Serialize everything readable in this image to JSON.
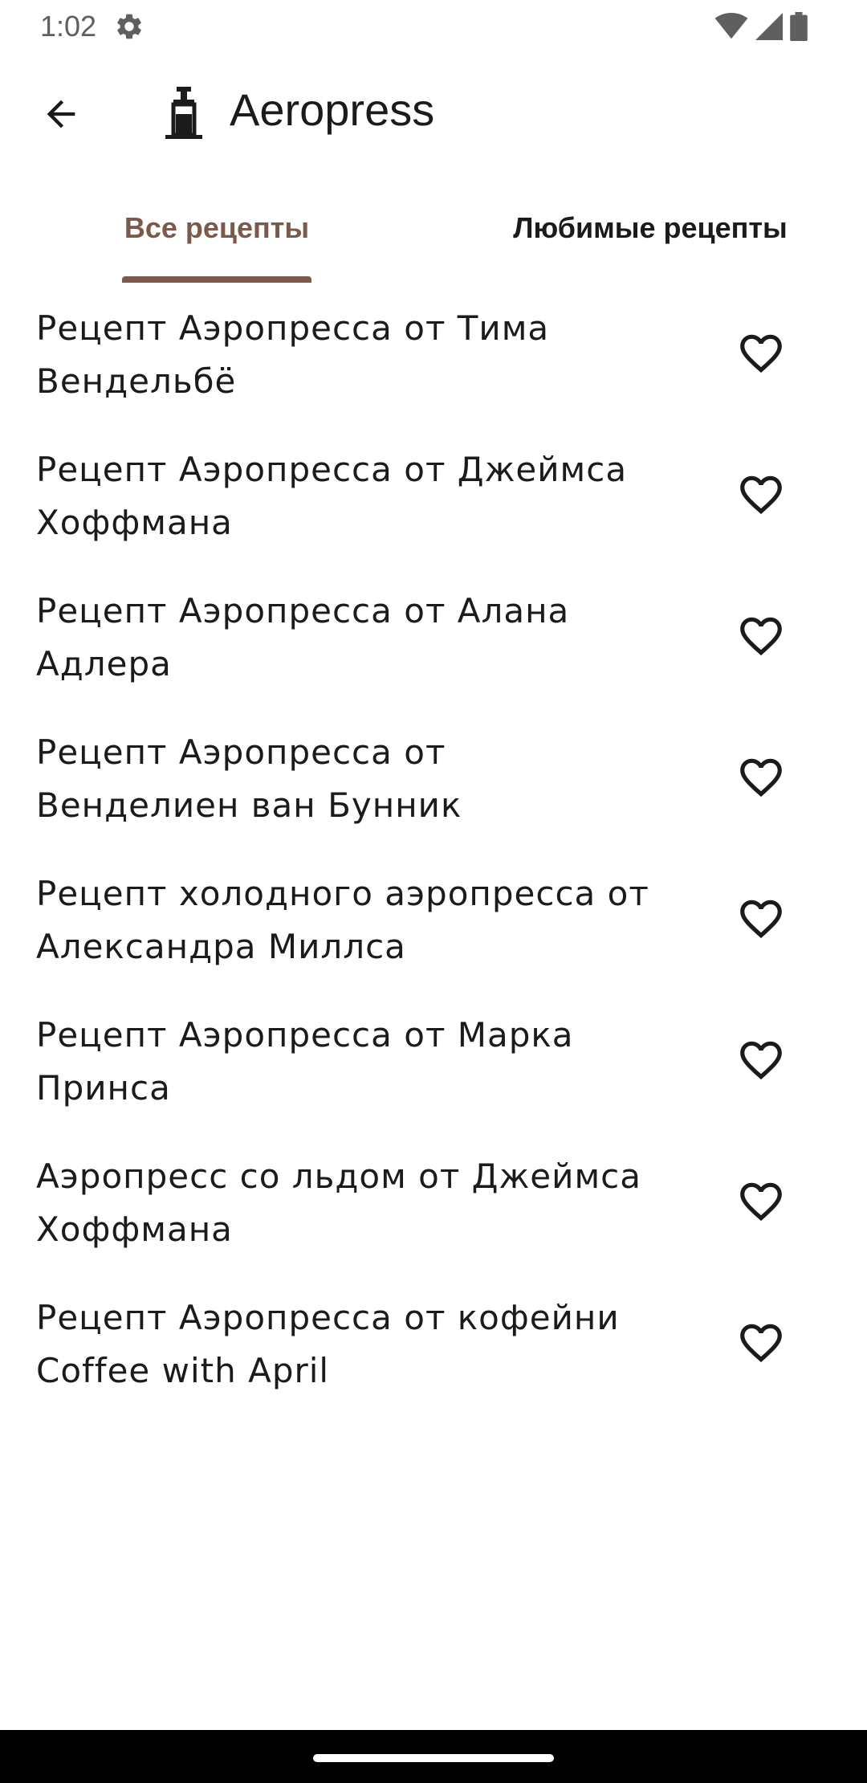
{
  "status_bar": {
    "time": "1:02",
    "icons": [
      "gear-icon",
      "wifi-icon",
      "signal-icon",
      "battery-icon"
    ]
  },
  "app_bar": {
    "back_icon": "arrow-back-icon",
    "device_icon": "aeropress-icon",
    "title": "Aeropress"
  },
  "tabs": [
    {
      "label": "Все рецепты",
      "selected": true
    },
    {
      "label": "Любимые рецепты",
      "selected": false
    }
  ],
  "colors": {
    "accent": "#7b5a4c",
    "text": "#1b1b1b",
    "status_text": "#5f5f5f"
  },
  "recipes": [
    {
      "name": "Рецепт Аэропресса от Тима Вендельбё",
      "favorite": false
    },
    {
      "name": "Рецепт Аэропресса от Джеймса Хоффмана",
      "favorite": false
    },
    {
      "name": "Рецепт Аэропресса от Алана Адлера",
      "favorite": false
    },
    {
      "name": "Рецепт Аэропресса от Венделиен ван Бунник",
      "favorite": false
    },
    {
      "name": "Рецепт холодного аэропресса от Александра Миллса",
      "favorite": false
    },
    {
      "name": "Рецепт Аэропресса от Марка Принса",
      "favorite": false
    },
    {
      "name": "Аэропресс со льдом от Джеймса Хоффмана",
      "favorite": false
    },
    {
      "name": "Рецепт Аэропресса от кофейни Coffee with April",
      "favorite": false
    }
  ]
}
